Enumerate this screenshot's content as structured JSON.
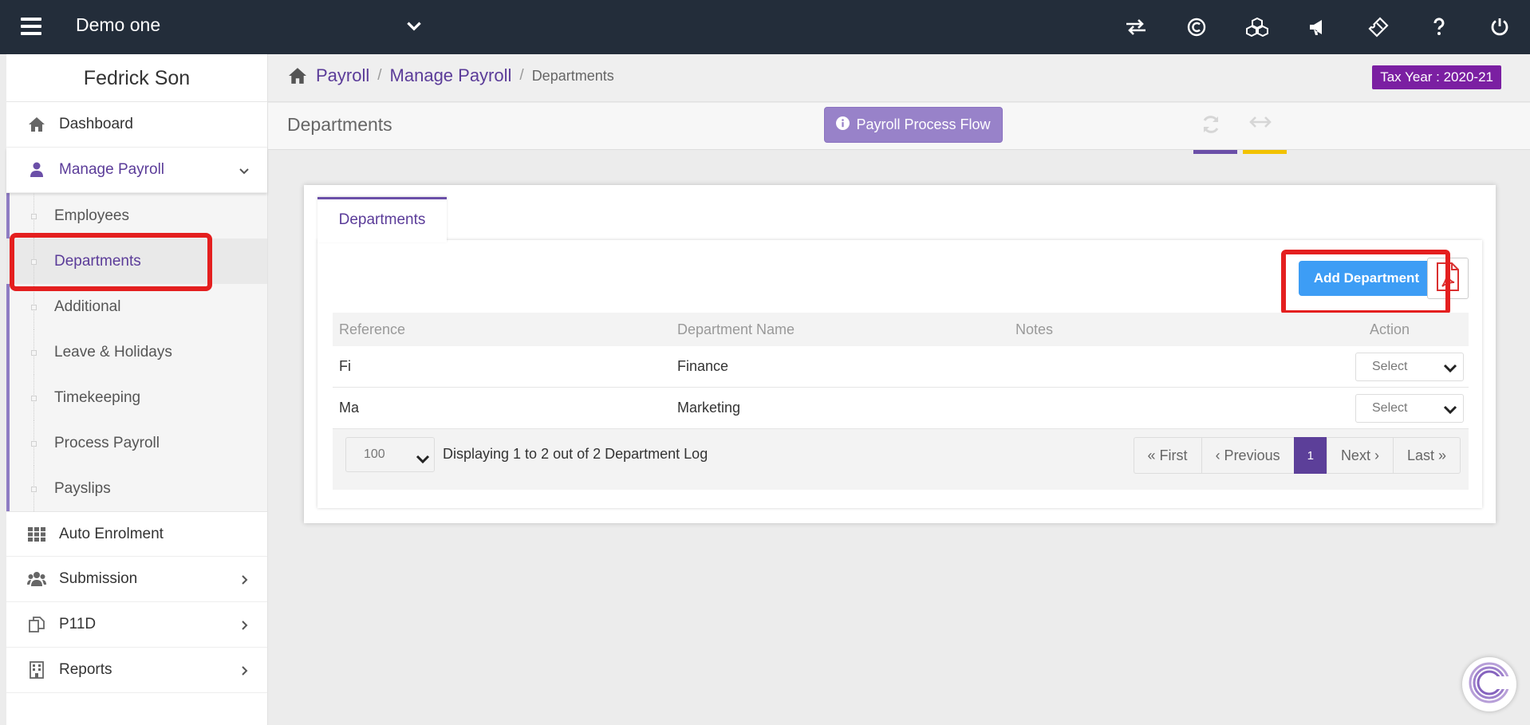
{
  "topbar": {
    "company": "Demo one",
    "icons": [
      "transfer-icon",
      "copyright-icon",
      "cubes-icon",
      "bullhorn-icon",
      "ticket-icon",
      "help-icon",
      "power-icon"
    ]
  },
  "sidebar": {
    "user_name": "Fedrick Son",
    "items": [
      {
        "label": "Dashboard",
        "icon": "home-icon"
      },
      {
        "label": "Manage Payroll",
        "icon": "user-icon"
      },
      {
        "label": "Auto Enrolment",
        "icon": "grid-icon"
      },
      {
        "label": "Submission",
        "icon": "users-icon"
      },
      {
        "label": "P11D",
        "icon": "copy-icon"
      },
      {
        "label": "Reports",
        "icon": "building-icon"
      }
    ],
    "submenu": [
      "Employees",
      "Departments",
      "Additional",
      "Leave & Holidays",
      "Timekeeping",
      "Process Payroll",
      "Payslips"
    ]
  },
  "breadcrumb": {
    "items": [
      "Payroll",
      "Manage Payroll"
    ],
    "current": "Departments"
  },
  "tax_year": "Tax Year : 2020-21",
  "page": {
    "title": "Departments",
    "flow_button": "Payroll Process Flow"
  },
  "panel": {
    "tab": "Departments",
    "add_button": "Add Department",
    "columns": [
      "Reference",
      "Department Name",
      "Notes",
      "Action"
    ],
    "rows": [
      {
        "reference": "Fi",
        "name": "Finance",
        "notes": "",
        "action": "Select"
      },
      {
        "reference": "Ma",
        "name": "Marketing",
        "notes": "",
        "action": "Select"
      }
    ],
    "per_page": "100",
    "display_text": "Displaying 1 to 2 out of 2 Department Log",
    "pager": {
      "first": "« First",
      "previous": "‹ Previous",
      "page": "1",
      "next": "Next ›",
      "last": "Last »"
    }
  },
  "colors": {
    "topbar": "#232d3a",
    "accent_purple": "#5b3c99",
    "tax_badge": "#7b1fa2",
    "add_button": "#3d9df5",
    "highlight_red": "#e41f1f",
    "refresh_bar": "#6b4fa8",
    "expand_bar": "#f2c200"
  }
}
